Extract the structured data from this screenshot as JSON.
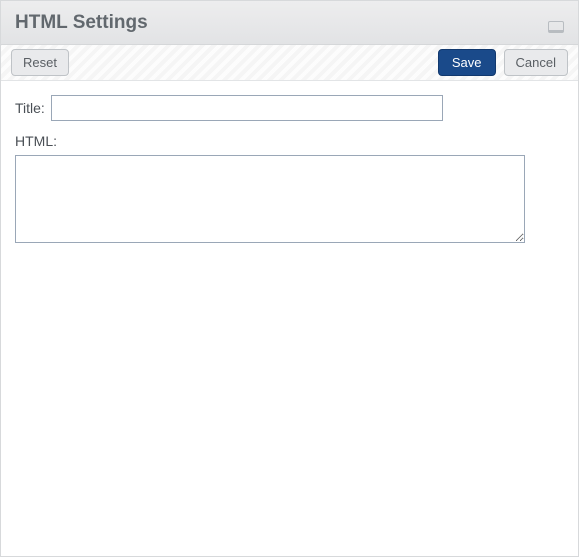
{
  "header": {
    "title": "HTML Settings"
  },
  "toolbar": {
    "reset_label": "Reset",
    "save_label": "Save",
    "cancel_label": "Cancel"
  },
  "form": {
    "title_label": "Title:",
    "title_value": "",
    "html_label": "HTML:",
    "html_value": ""
  }
}
